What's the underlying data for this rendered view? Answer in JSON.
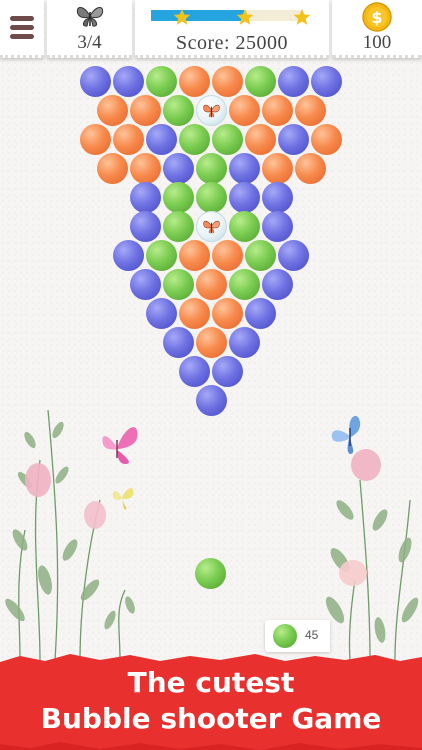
{
  "hud": {
    "menu_icon": "hamburger-menu-icon",
    "level_icon": "butterfly-icon",
    "level_progress": "3/4",
    "score_label": "Score:",
    "score_value": "25000",
    "score_text": "Score:  25000",
    "score_progress_fraction": 0.62,
    "stars_total": 3,
    "coin_icon": "gold-dollar-coin-icon",
    "coins": "100"
  },
  "board": {
    "rows": [
      [
        "blue",
        "blue",
        "green",
        "orange",
        "orange",
        "green",
        "blue",
        "blue"
      ],
      [
        "orange",
        "orange",
        "green",
        "clear",
        "orange",
        "orange",
        "orange"
      ],
      [
        "orange",
        "orange",
        "blue",
        "green",
        "green",
        "orange",
        "blue",
        "orange"
      ],
      [
        "orange",
        "orange",
        "blue",
        "green",
        "blue",
        "orange",
        "orange"
      ],
      [
        "blue",
        "green",
        "green",
        "blue",
        "blue"
      ],
      [
        "blue",
        "green",
        "clear",
        "green",
        "blue"
      ],
      [
        "blue",
        "green",
        "orange",
        "orange",
        "green",
        "blue"
      ],
      [
        "blue",
        "green",
        "orange",
        "green",
        "blue"
      ],
      [
        "blue",
        "orange",
        "orange",
        "blue"
      ],
      [
        "blue",
        "orange",
        "blue"
      ],
      [
        "blue",
        "blue"
      ],
      [
        "blue"
      ]
    ],
    "trapped_item": "butterfly"
  },
  "shooter": {
    "current_color": "green",
    "next_color": "green",
    "shots_left": "45"
  },
  "banner": {
    "line1": "The cutest",
    "line2": "Bubble shooter Game",
    "color": "#e8302f"
  },
  "colors": {
    "blue": "#5c5fd8",
    "orange": "#f2783a",
    "green": "#6cc446",
    "accent": "#26a4df",
    "star": "#f2c21c"
  }
}
